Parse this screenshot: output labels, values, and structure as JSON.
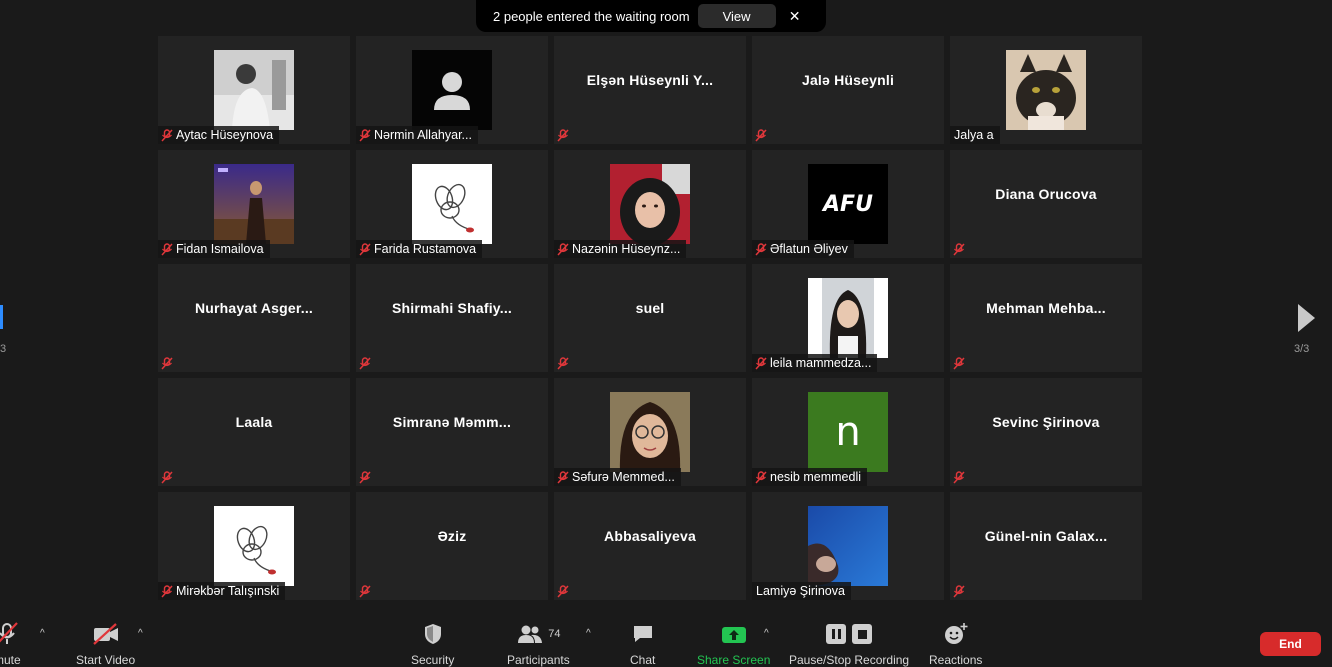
{
  "banner": {
    "message": "2 people entered the waiting room",
    "view_label": "View",
    "close_symbol": "✕"
  },
  "pagination": {
    "left_label": "3",
    "right_label": "3/3"
  },
  "participants": [
    {
      "name": "Aytac Hüseynova",
      "has_video": true,
      "pic": "photo-woman-bw",
      "muted": true
    },
    {
      "name": "Nərmin Allahyar...",
      "has_video": true,
      "pic": "default-avatar",
      "muted": true
    },
    {
      "name": "Elşən  Hüseynli  Y...",
      "has_video": false,
      "muted": true
    },
    {
      "name": "Jalə Hüseynli",
      "has_video": false,
      "muted": true
    },
    {
      "name": "Jalya a",
      "has_video": true,
      "pic": "photo-cat",
      "muted": false
    },
    {
      "name": "Fidan Ismailova",
      "has_video": true,
      "pic": "photo-night",
      "muted": true
    },
    {
      "name": "Farida Rustamova",
      "has_video": true,
      "pic": "photo-flower",
      "muted": true
    },
    {
      "name": "Nazənin Hüseynz...",
      "has_video": true,
      "pic": "photo-hijab",
      "muted": true
    },
    {
      "name": "Əflatun Əliyev",
      "has_video": true,
      "pic": "logo-afu",
      "logo_text": "AFU",
      "muted": true
    },
    {
      "name": "Diana Orucova",
      "has_video": false,
      "muted": true
    },
    {
      "name": "Nurhayat  Asger...",
      "has_video": false,
      "muted": true
    },
    {
      "name": "Shirmahi  Shafiy...",
      "has_video": false,
      "muted": true
    },
    {
      "name": "suel",
      "has_video": false,
      "muted": true
    },
    {
      "name": "leila mammedza...",
      "has_video": true,
      "pic": "photo-girl",
      "muted": true
    },
    {
      "name": "Mehman  Mehba...",
      "has_video": false,
      "muted": true
    },
    {
      "name": "Laala",
      "has_video": false,
      "muted": true
    },
    {
      "name": "Simranə  Məmm...",
      "has_video": false,
      "muted": true
    },
    {
      "name": "Səfurə Memmed...",
      "has_video": true,
      "pic": "photo-glasses",
      "muted": true
    },
    {
      "name": "nesib memmedli",
      "has_video": true,
      "pic": "letter-avatar",
      "letter": "n",
      "muted": true
    },
    {
      "name": "Sevinc Şirinova",
      "has_video": false,
      "muted": true
    },
    {
      "name": "Mirəkbər Talışınski",
      "has_video": true,
      "pic": "photo-flower",
      "muted": true
    },
    {
      "name": "Əziz",
      "has_video": false,
      "muted": true
    },
    {
      "name": "Abbasaliyeva",
      "has_video": false,
      "muted": true
    },
    {
      "name": "Lamiyə Şirinova",
      "has_video": true,
      "pic": "photo-blue",
      "muted": false
    },
    {
      "name": "Günel-nin  Galax...",
      "has_video": false,
      "muted": true
    }
  ],
  "toolbar": {
    "unmute_label": "mute",
    "start_video_label": "Start Video",
    "security_label": "Security",
    "participants_label": "Participants",
    "participants_count": "74",
    "chat_label": "Chat",
    "share_screen_label": "Share Screen",
    "recording_label": "Pause/Stop Recording",
    "reactions_label": "Reactions",
    "end_label": "End"
  },
  "colors": {
    "background": "#1a1a1a",
    "tile": "#232323",
    "muted_icon": "#e0373b",
    "share_green": "#23c552",
    "end_red": "#d72b2b",
    "accent_blue": "#2d8cff",
    "letter_avatar_green": "#3b7a1f"
  }
}
